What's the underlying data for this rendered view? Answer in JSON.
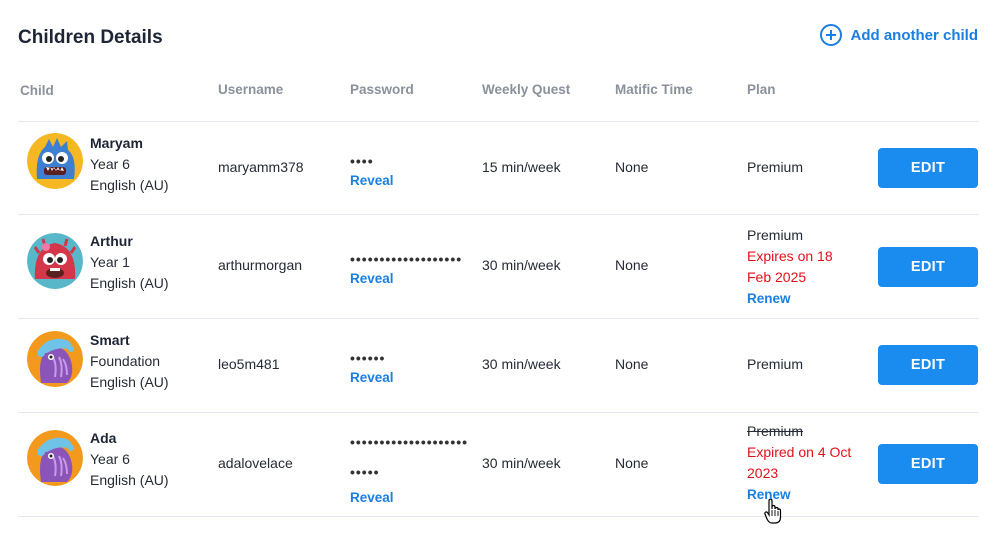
{
  "page": {
    "title": "Children Details",
    "add_child_label": "Add another child"
  },
  "columns": {
    "child": "Child",
    "username": "Username",
    "password": "Password",
    "weekly_quest": "Weekly Quest",
    "matific_time": "Matific Time",
    "plan": "Plan"
  },
  "children": [
    {
      "name": "Maryam",
      "year": "Year 6",
      "language": "English (AU)",
      "avatar_icon": "blue-monster-avatar",
      "username": "maryamm378",
      "password_lines": [
        "••••"
      ],
      "reveal_label": "Reveal",
      "weekly_quest": "15 min/week",
      "matific_time": "None",
      "plan": "Premium",
      "edit_label": "EDIT"
    },
    {
      "name": "Arthur",
      "year": "Year 1",
      "language": "English (AU)",
      "avatar_icon": "red-monster-avatar",
      "username": "arthurmorgan",
      "password_lines": [
        "•••••••••••••••••••"
      ],
      "reveal_label": "Reveal",
      "weekly_quest": "30 min/week",
      "matific_time": "None",
      "plan": "Premium",
      "plan_status": "Expires on 18 Feb 2025",
      "renew_label": "Renew",
      "edit_label": "EDIT"
    },
    {
      "name": "Smart",
      "year": "Foundation",
      "language": "English (AU)",
      "avatar_icon": "purple-monster-avatar",
      "username": "leo5m481",
      "password_lines": [
        "••••••"
      ],
      "reveal_label": "Reveal",
      "weekly_quest": "30 min/week",
      "matific_time": "None",
      "plan": "Premium",
      "edit_label": "EDIT"
    },
    {
      "name": "Ada",
      "year": "Year 6",
      "language": "English (AU)",
      "avatar_icon": "purple-monster-avatar",
      "username": "adalovelace",
      "password_lines": [
        "••••••••••••••••••••",
        "•••••"
      ],
      "reveal_label": "Reveal",
      "weekly_quest": "30 min/week",
      "matific_time": "None",
      "plan": "Premium",
      "plan_status": "Expired on 4 Oct 2023",
      "renew_label": "Renew",
      "edit_label": "EDIT"
    }
  ],
  "colors": {
    "accent_blue": "#1a8cf0",
    "link_blue": "#1a7fe0",
    "warning_red": "#e0121a"
  }
}
